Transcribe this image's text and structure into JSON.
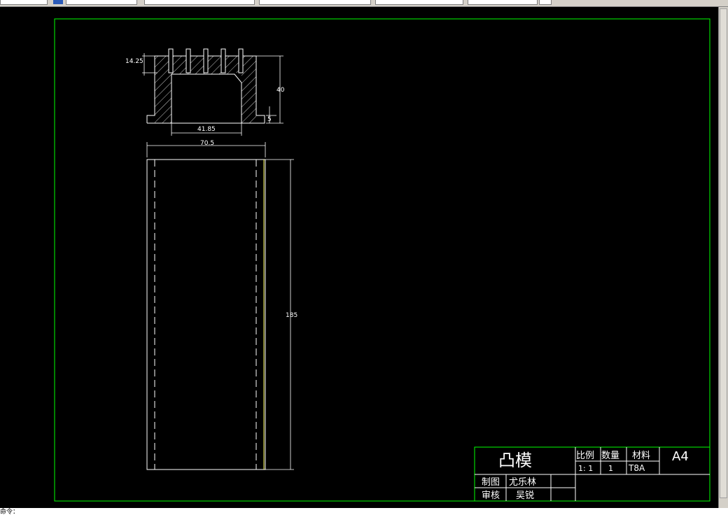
{
  "colors": {
    "border": "#00ff00",
    "outline": "#ffffff",
    "dimension": "#ffffff",
    "centerline": "#ffff66",
    "background": "#000000"
  },
  "drawing": {
    "dimensions": {
      "top_height": "14.25",
      "total_height": "40",
      "flange": "5",
      "inner_width": "41.85",
      "outer_width": "70.5",
      "length": "185"
    }
  },
  "title_block": {
    "part_name": "凸模",
    "scale_label": "比例",
    "quantity_label": "数量",
    "material_label": "材料",
    "sheet_size": "A4",
    "scale_value": "1: 1",
    "quantity_value": "1",
    "material_value": "T8A",
    "drawn_by_label": "制图",
    "drawn_by": "尤乐林",
    "checked_by_label": "审核",
    "checked_by": "吴锐"
  },
  "status": {
    "command_hint": "命令："
  }
}
